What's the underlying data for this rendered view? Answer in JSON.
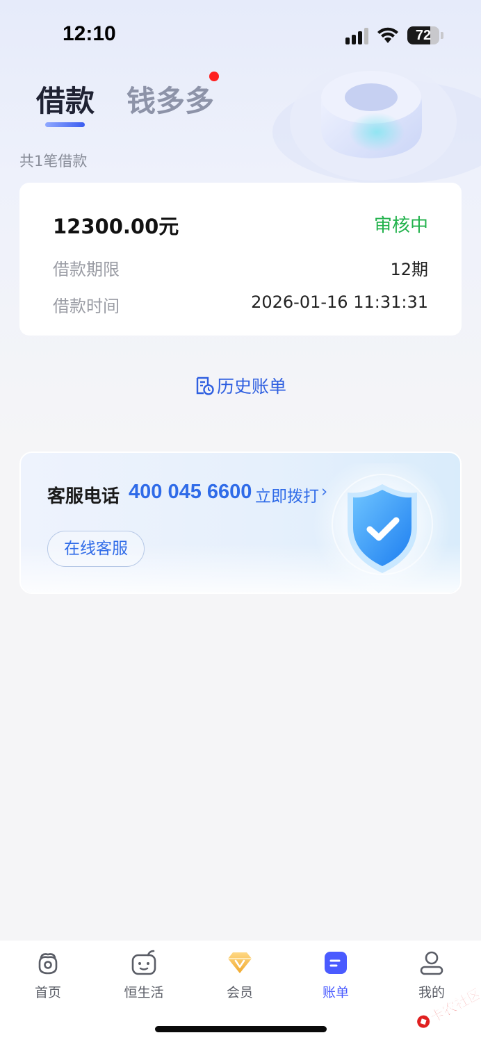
{
  "status_bar": {
    "time": "12:10",
    "battery_level": "72",
    "battery_fraction": 0.72
  },
  "tabs": [
    {
      "label": "借款",
      "active": true
    },
    {
      "label": "钱多多",
      "active": false,
      "has_badge": true
    }
  ],
  "loan_count_text": "共1笔借款",
  "loan": {
    "amount": "12300.00元",
    "status": "审核中",
    "term_label": "借款期限",
    "term_value": "12期",
    "time_label": "借款时间",
    "time_value": "2026-01-16 11:31:31"
  },
  "history_link": {
    "label": "历史账单",
    "icon": "bill-history-icon"
  },
  "service": {
    "label": "客服电话",
    "phone": "400 045 6600",
    "call_label": "立即拨打",
    "online_label": "在线客服",
    "icon": "shield-check-icon"
  },
  "bottom_nav": [
    {
      "label": "首页",
      "icon": "home-icon"
    },
    {
      "label": "恒生活",
      "icon": "life-icon"
    },
    {
      "label": "会员",
      "icon": "diamond-icon"
    },
    {
      "label": "账单",
      "icon": "bill-icon",
      "active": true
    },
    {
      "label": "我的",
      "icon": "profile-icon"
    }
  ],
  "watermark": {
    "text": "卡农社区"
  },
  "colors": {
    "accent": "#2f6be8",
    "status_green": "#22b24c",
    "nav_active": "#4a5bff",
    "badge_red": "#ff1f1f"
  }
}
